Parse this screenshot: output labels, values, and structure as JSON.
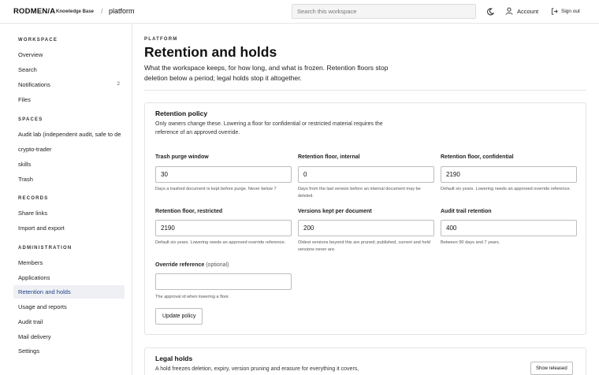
{
  "header": {
    "brand": "RODMEN/A",
    "brand_sub": "Knowledge Base",
    "separator": "/",
    "workspace": "platform",
    "search_placeholder": "Search this workspace",
    "account_label": "Account",
    "signout_label": "Sign out"
  },
  "sidebar": {
    "sections": [
      {
        "title": "WORKSPACE",
        "items": [
          {
            "label": "Overview"
          },
          {
            "label": "Search"
          },
          {
            "label": "Notifications",
            "badge": "2"
          },
          {
            "label": "Files"
          }
        ]
      },
      {
        "title": "SPACES",
        "items": [
          {
            "label": "Audit lab (independent audit, safe to de"
          },
          {
            "label": "crypto-trader"
          },
          {
            "label": "skills"
          },
          {
            "label": "Trash"
          }
        ]
      },
      {
        "title": "RECORDS",
        "items": [
          {
            "label": "Share links"
          },
          {
            "label": "Import and export"
          }
        ]
      },
      {
        "title": "ADMINISTRATION",
        "items": [
          {
            "label": "Members"
          },
          {
            "label": "Applications"
          },
          {
            "label": "Retention and holds",
            "active": true
          },
          {
            "label": "Usage and reports"
          },
          {
            "label": "Audit trail"
          },
          {
            "label": "Mail delivery"
          },
          {
            "label": "Settings"
          }
        ]
      }
    ]
  },
  "page": {
    "eyebrow": "PLATFORM",
    "title": "Retention and holds",
    "description": "What the workspace keeps, for how long, and what is frozen. Retention floors stop deletion below a period; legal holds stop it altogether."
  },
  "policy": {
    "title": "Retention policy",
    "description": "Only owners change these. Lowering a floor for confidential or restricted material requires the reference of an approved override.",
    "fields": {
      "trash_purge": {
        "label": "Trash purge window",
        "value": "30",
        "hint": "Days a trashed document is kept before purge. Never below 7"
      },
      "floor_internal": {
        "label": "Retention floor, internal",
        "value": "0",
        "hint": "Days from the last version before an internal document may be deleted."
      },
      "floor_confidential": {
        "label": "Retention floor, confidential",
        "value": "2190",
        "hint": "Default six years. Lowering needs an approved override reference."
      },
      "floor_restricted": {
        "label": "Retention floor, restricted",
        "value": "2190",
        "hint": "Default six years. Lowering needs an approved override reference."
      },
      "versions_kept": {
        "label": "Versions kept per document",
        "value": "200",
        "hint": "Oldest versions beyond this are pruned; published, current and held versions never are."
      },
      "audit_retention": {
        "label": "Audit trail retention",
        "value": "400",
        "hint": "Between 90 days and 7 years."
      },
      "override_ref": {
        "label": "Override reference",
        "optional": "(optional)",
        "value": "",
        "hint": "The approval id when lowering a floor."
      }
    },
    "submit_label": "Update policy"
  },
  "holds": {
    "title": "Legal holds",
    "description": "A hold freezes deletion, expiry, version pruning and erasure for everything it covers,",
    "show_released_label": "Show released"
  }
}
